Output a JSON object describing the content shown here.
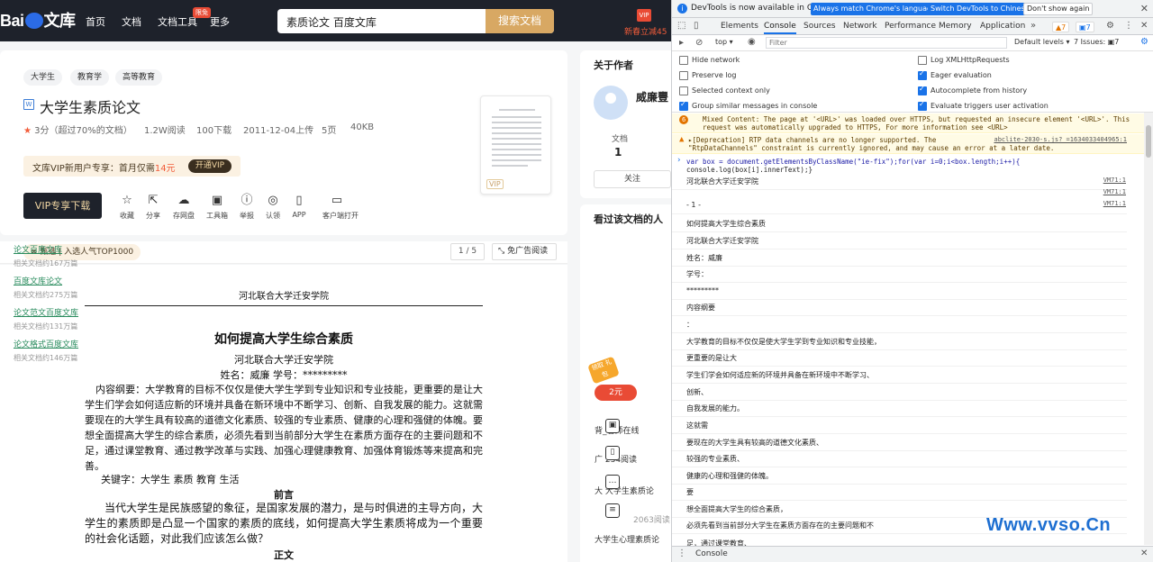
{
  "baidu": {
    "logo": "Bai文库",
    "nav": [
      "首页",
      "文档",
      "文档工具",
      "更多"
    ],
    "nav_badge": "限免",
    "search_query": "素质论文 百度文库",
    "search_button": "搜索文档",
    "promo_icon": "VIP",
    "promo": "新春立减45"
  },
  "doc": {
    "tags": [
      "大学生",
      "教育学",
      "高等教育"
    ],
    "title": "大学生素质论文",
    "type_icon": "W",
    "rating": "3分",
    "rating_note": "（超过70%的文档）",
    "reads": "1.2W阅读",
    "downloads": "100下载",
    "uploaded": "2011-12-04上传",
    "pages": "5页",
    "size": "40KB",
    "vip_offer_prefix": "文库VIP新用户专享：首月仅需",
    "vip_offer_price": "14元",
    "vip_open": "开通VIP",
    "download_button": "VIP专享下载",
    "actions": [
      "收藏",
      "分享",
      "存网盘",
      "工具箱",
      "举报",
      "认领",
      "APP",
      "客户端打开"
    ],
    "thumb_label": "VIP",
    "quality_pill": "甄选 | 入选人气TOP1000",
    "page_indicator": "1 / 5",
    "no_ad": "免广告阅读"
  },
  "content": {
    "school": "河北联合大学迁安学院",
    "heading": "如何提高大学生综合素质",
    "school2": "河北联合大学迁安学院",
    "name_line": "姓名：威廉     学号：*********",
    "abstract": "内容纲要：大学教育的目标不仅仅是使大学生学到专业知识和专业技能，更重要的是让大学生们学会如何适应新的环境并具备在新环境中不断学习、创新、自我发展的能力。这就需要现在的大学生具有较高的道德文化素质、较强的专业素质、健康的心理和强健的体魄。要想全面提高大学生的综合素质，必须先看到当前部分大学生在素质方面存在的主要问题和不足，通过课堂教育、通过教学改革与实践、加强心理健康教育、加强体育锻炼等来提高和完善。",
    "keywords": "关键字：大学生   素质   教育   生活",
    "preface": "前言",
    "intro": "当代大学生是民族感望的象征，是国家发展的潜力，是与时俱进的主导方向，大学生的素质即是凸显一个国家的素质的底线，如何提高大学生素质将成为一个重要的社会化话题，对此我们应该怎么做？",
    "next_heading": "正文"
  },
  "sidebar": {
    "about_author": "关于作者",
    "author_name": "威廉豐",
    "docs_label": "文档",
    "docs_count": "1",
    "follow": "关注",
    "viewed_title": "看过该文档的人",
    "related": [
      {
        "title": "论文百度文库",
        "meta": "相关文档约167万篇"
      },
      {
        "title": "百度文库论文",
        "meta": "相关文档约275万篇"
      },
      {
        "title": "论文范文百度文库",
        "meta": "相关文档约131万篇"
      },
      {
        "title": "论文格式百度文库",
        "meta": "相关文档约146万篇"
      }
    ],
    "coupon": "2元",
    "coupon_tag": "领取 礼包",
    "rows": [
      "背_名师在线",
      "广 234阅读",
      "大 大学生素质论",
      "2063阅读",
      "大学生心理素质论"
    ]
  },
  "devtools": {
    "info_text": "DevTools is now available in Chinese!",
    "btn_match": "Always match Chrome's language",
    "btn_switch": "Switch DevTools to Chinese",
    "btn_dont": "Don't show again",
    "tabs": [
      "Elements",
      "Console",
      "Sources",
      "Network",
      "Performance",
      "Memory",
      "Application"
    ],
    "warn_count": "7",
    "err_count": "7",
    "context": "top",
    "filter_placeholder": "Filter",
    "levels": "Default levels",
    "issues": "7 Issues: ▣7",
    "settings": [
      {
        "label": "Hide network",
        "checked": false
      },
      {
        "label": "Log XMLHttpRequests",
        "checked": false
      },
      {
        "label": "Preserve log",
        "checked": false
      },
      {
        "label": "Eager evaluation",
        "checked": true
      },
      {
        "label": "Selected context only",
        "checked": false
      },
      {
        "label": "Autocomplete from history",
        "checked": true
      },
      {
        "label": "Group similar messages in console",
        "checked": true
      },
      {
        "label": "Evaluate triggers user activation",
        "checked": true
      }
    ],
    "mixed_count": "6",
    "mixed_line1": "Mixed Content: The page at '<URL>' was loaded over HTTPS, but requested an insecure element '<URL>'. This",
    "mixed_line2": "request was automatically upgraded to HTTPS, For more information see <URL>",
    "depr_line1": "▸[Deprecation] RTP data channels are no longer supported. The",
    "depr_line2": "\"RtpDataChannels\" constraint is currently ignored, and may cause an error at a later date.",
    "depr_src": "abclite-2030-s.js?_=1634033404965:1",
    "cmd_line1": "var box = document.getElementsByClassName(\"ie-fix\");for(var i=0;i<box.length;i++){",
    "cmd_line2": "console.log(box[i].innerText);}",
    "vm_src": "VM71:1",
    "output": [
      "河北联合大学迁安学院",
      "- 1 -",
      "如何提高大学生综合素质",
      "河北联合大学迁安学院",
      "姓名：威廉",
      "学号：",
      "*********",
      "内容纲要",
      "：",
      "大学教育的目标不仅仅是使大学生学到专业知识和专业技能，",
      "更重要的是让大",
      "学生们学会如何适应新的环境并具备在新环境中不断学习、",
      "创新、",
      "自我发展的能力。",
      "这就需",
      "要现在的大学生具有较高的道德文化素质、",
      "较强的专业素质、",
      "健康的心理和强健的体魄。",
      "要",
      "想全面提高大学生的综合素质，",
      "必须先看到当前部分大学生在素质方面存在的主要问题和不",
      "足，通过课堂教育、"
    ],
    "drawer_tab": "Console"
  },
  "watermark": "Www.vvso.Cn"
}
